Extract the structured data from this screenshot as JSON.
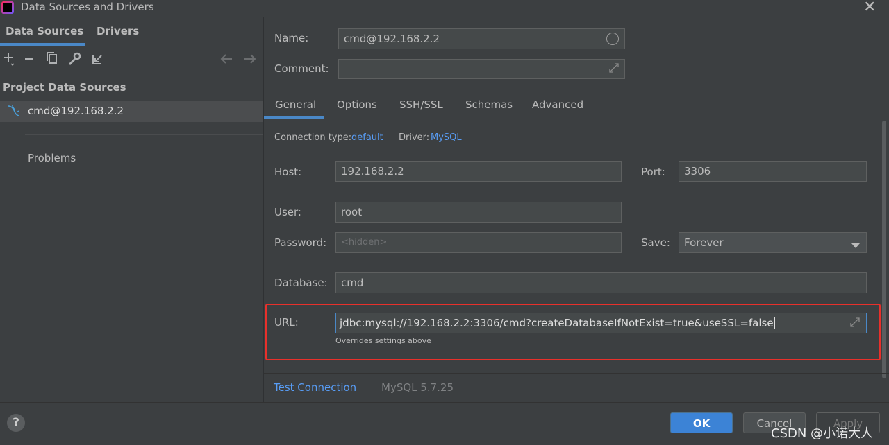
{
  "window": {
    "title": "Data Sources and Drivers",
    "close": "✕"
  },
  "left": {
    "tabs": [
      "Data Sources",
      "Drivers"
    ],
    "section_title": "Project Data Sources",
    "items": [
      {
        "label": "cmd@192.168.2.2"
      }
    ],
    "problems": "Problems"
  },
  "form": {
    "name_label": "Name:",
    "name_value": "cmd@192.168.2.2",
    "comment_label": "Comment:",
    "comment_value": "",
    "tabs": [
      "General",
      "Options",
      "SSH/SSL",
      "Schemas",
      "Advanced"
    ],
    "connection_type_label": "Connection type:",
    "connection_type_value": "default",
    "driver_label": "Driver:",
    "driver_value": "MySQL",
    "host_label": "Host:",
    "host_value": "192.168.2.2",
    "port_label": "Port:",
    "port_value": "3306",
    "user_label": "User:",
    "user_value": "root",
    "password_label": "Password:",
    "password_placeholder": "<hidden>",
    "save_label": "Save:",
    "save_value": "Forever",
    "database_label": "Database:",
    "database_value": "cmd",
    "url_label": "URL:",
    "url_value": "jdbc:mysql://192.168.2.2:3306/cmd?createDatabaseIfNotExist=true&useSSL=false",
    "url_hint": "Overrides settings above",
    "test_connection": "Test Connection",
    "server_version": "MySQL 5.7.25"
  },
  "buttons": {
    "help": "?",
    "ok": "OK",
    "cancel": "Cancel",
    "apply": "Apply"
  },
  "watermark": "CSDN @小诺大人"
}
